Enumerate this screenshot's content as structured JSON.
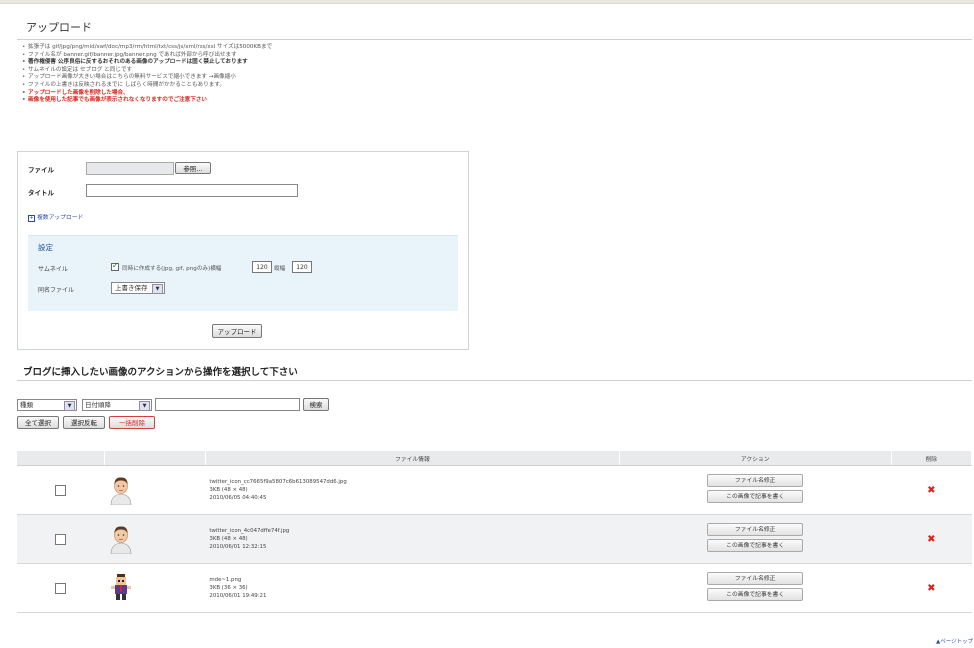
{
  "page_title": "アップロード",
  "notes": [
    {
      "text": "拡張子は gif/jpg/png/mid/swf/doc/mp3/rm/html/txt/css/js/xml/rss/xsl サイズは5000KBまで",
      "style": "normal"
    },
    {
      "text": "ファイル名が banner.gif/banner.jpg/banner.png であれば外部から呼び出せます",
      "style": "normal"
    },
    {
      "text": "著作権侵害 公序良俗に反するおそれのある画像のアップロードは固く禁止しております",
      "style": "bold"
    },
    {
      "text": "サムネイルの設定は セブログ と同じです",
      "style": "normal"
    },
    {
      "text": "アップロード画像が大きい場合はこちらの無料サービスで縮小できます →画像縮小",
      "style": "normal"
    },
    {
      "text": "ファイルの上書きは反映されるまでに しばらく時間がかかることもあります。",
      "style": "normal"
    },
    {
      "text": "アップロードした画像を削除した場合、",
      "style": "red"
    },
    {
      "text": "画像を使用した記事でも画像が表示されなくなりますのでご注意下さい",
      "style": "red-indent"
    }
  ],
  "form": {
    "file_label": "ファイル",
    "browse_button": "参照...",
    "title_label": "タイトル",
    "title_value": "",
    "multi_upload_link": "複数アップロード",
    "settings_title": "設定",
    "thumbnail_label": "サムネイル",
    "thumbnail_checked": true,
    "thumbnail_text": "同時に作成する(jpg, gif, pngのみ)横幅",
    "thumb_width": "120",
    "thumb_height_label": "縦幅",
    "thumb_height": "120",
    "same_name_label": "同名ファイル",
    "same_name_value": "上書き保存",
    "upload_button": "アップロード"
  },
  "section_title": "ブログに挿入したい画像のアクションから操作を選択して下さい",
  "controls": {
    "type_select": "種類",
    "date_select": "日付順降",
    "search_value": "",
    "search_button": "検索",
    "select_all": "全て選択",
    "invert_selection": "選択反転",
    "delete_selected": "一括削除"
  },
  "table": {
    "headers": [
      "",
      "",
      "ファイル情報",
      "アクション",
      "削除"
    ],
    "action_rename": "ファイル名修正",
    "action_write": "この画像で記事を書く",
    "rows": [
      {
        "name": "twitter_icon_cc7665f9a5807c6b613089547dd6.jpg",
        "size": "3KB (48 × 48)",
        "date": "2010/06/05 04:40:45",
        "checked": false,
        "thumb": "avatar-man-icon"
      },
      {
        "name": "twitter_icon_4c047dffe74f.jpg",
        "size": "3KB (48 × 48)",
        "date": "2010/06/01 12:32:15",
        "checked": false,
        "thumb": "avatar-man-icon"
      },
      {
        "name": "mde~1.png",
        "size": "3KB (36 × 36)",
        "date": "2010/06/01 19:49:21",
        "checked": false,
        "thumb": "pixel-character-icon"
      }
    ]
  },
  "page_top": "ページトップ",
  "colors": {
    "link": "#2a49a8",
    "warning": "#e0201a",
    "settings_bg": "#e8f3fa",
    "table_header_bg": "#e9eaec",
    "alt_row_bg": "#f1f2f4"
  }
}
